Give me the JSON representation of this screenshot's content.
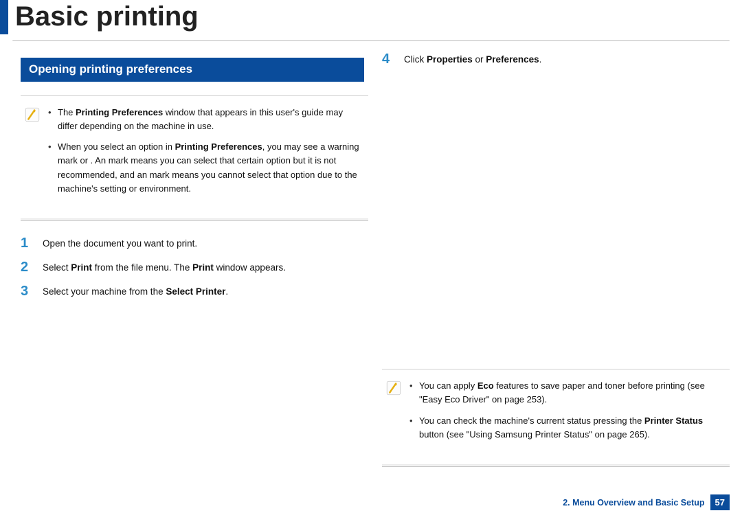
{
  "title": "Basic printing",
  "section_title": "Opening printing preferences",
  "notes_left": {
    "n1_a": "The ",
    "n1_b": "Printing Preferences",
    "n1_c": " window that appears in this user's guide may differ depending on the machine in use.",
    "n2_a": "When you select an option in ",
    "n2_b": "Printing Preferences",
    "n2_c": ", you may see a warning mark ",
    "n2_d": " or ",
    "n2_e": ". An ",
    "n2_f": " mark means you can select that certain option but it is not recommended, and an ",
    "n2_g": " mark means you cannot select that option due to the machine's setting or environment."
  },
  "steps": {
    "s1_num": "1",
    "s1_text": "Open the document you want to print.",
    "s2_num": "2",
    "s2_a": "Select ",
    "s2_b": "Print",
    "s2_c": " from the file menu. The ",
    "s2_d": "Print",
    "s2_e": " window appears.",
    "s3_num": "3",
    "s3_a": "Select your machine from the ",
    "s3_b": "Select Printer",
    "s3_c": ".",
    "s4_num": "4",
    "s4_a": "Click ",
    "s4_b": "Properties",
    "s4_c": " or ",
    "s4_d": "Preferences",
    "s4_e": "."
  },
  "notes_right": {
    "r1_a": "You can apply ",
    "r1_b": "Eco",
    "r1_c": " features to save paper and toner before printing (see \"Easy Eco Driver\" on page 253).",
    "r2_a": "You can check the machine's current status pressing the ",
    "r2_b": "Printer Status",
    "r2_c": " button (see \"Using Samsung Printer Status\" on page 265)."
  },
  "footer": {
    "label": "2. Menu Overview and Basic Setup",
    "page": "57"
  }
}
